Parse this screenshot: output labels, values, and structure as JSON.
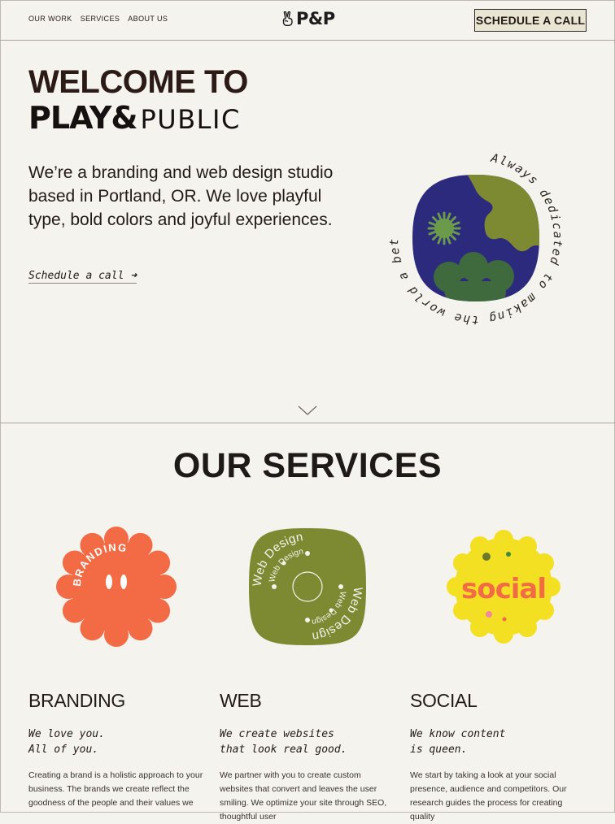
{
  "nav": {
    "items": [
      {
        "label": "OUR WORK"
      },
      {
        "label": "SERVICES"
      },
      {
        "label": "ABOUT US"
      }
    ],
    "logo_text": "P&P",
    "logo_icon": "peace-hand-icon",
    "cta_label": "SCHEDULE A CALL"
  },
  "hero": {
    "title_line1": "WELCOME TO",
    "brand_play": "PLAY&",
    "brand_public": "PUBLIC",
    "intro": "We’re a branding and web design studio based in Portland, OR. We love playful type, bold colors and joyful experiences.",
    "link_label": "Schedule a call",
    "link_arrow": "➜",
    "badge_ring_text": "Always dedicated to making the world a better place.",
    "scroll_icon": "chevron-down-icon"
  },
  "services": {
    "title": "OUR SERVICES",
    "items": [
      {
        "title": "BRANDING",
        "badge_text": "BRANDING",
        "tagline": "We love you.\nAll of you.",
        "body": "Creating a brand is a holistic approach to your business. The brands we create reflect the goodness of the people and their values we"
      },
      {
        "title": "WEB",
        "badge_text": "Web Design",
        "tagline": "We create websites\nthat look real good.",
        "body": "We partner with you to create custom websites that convert and leaves the user smiling. We optimize your site through SEO, thoughtful user"
      },
      {
        "title": "SOCIAL",
        "badge_text": "social",
        "tagline": "We know content\nis queen.",
        "body": "We start by taking a look at your social presence, audience and competitors. Our research guides the process for creating quality"
      }
    ]
  },
  "colors": {
    "background": "#f4f3ee",
    "text": "#231a17",
    "navy": "#2c2a7c",
    "olive": "#7e8a32",
    "green": "#3f6a3d",
    "orange": "#f26b45",
    "yellow": "#f4e023",
    "cta_bg": "#e9e5d3"
  }
}
